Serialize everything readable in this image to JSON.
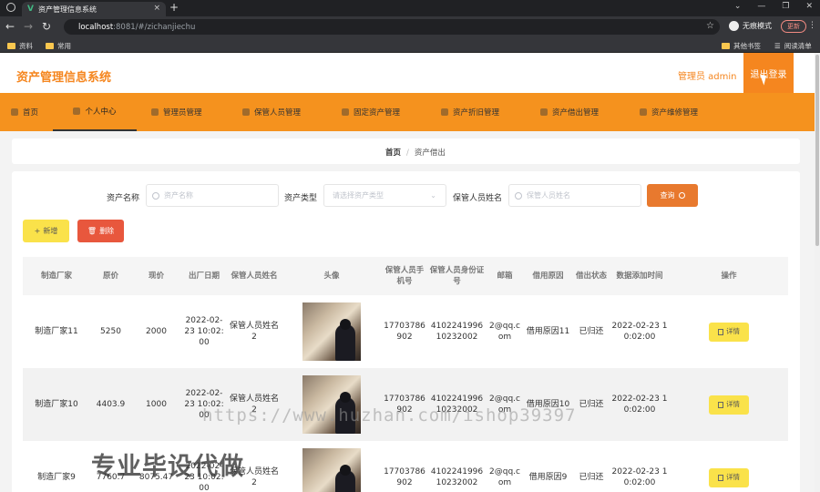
{
  "browser": {
    "tab_title": "资产管理信息系统",
    "tab_close": "×",
    "new_tab": "+",
    "url_host": "localhost",
    "url_rest": ":8081/#/zichanjiechu",
    "incognito": "无痕模式",
    "update": "更新",
    "window_controls": [
      "⌄",
      "—",
      "❐",
      "✕"
    ],
    "bookmarks": [
      "资料",
      "常用"
    ],
    "bookmarks_right": [
      "其他书签",
      "阅读清单"
    ]
  },
  "header": {
    "title": "资产管理信息系统",
    "user": "管理员 admin",
    "logout": "退出登录"
  },
  "nav": {
    "items": [
      {
        "label": "首页",
        "active": false
      },
      {
        "label": "个人中心",
        "active": true
      },
      {
        "label": "管理员管理",
        "active": false
      },
      {
        "label": "保管人员管理",
        "active": false
      },
      {
        "label": "固定资产管理",
        "active": false
      },
      {
        "label": "资产折旧管理",
        "active": false
      },
      {
        "label": "资产借出管理",
        "active": false
      },
      {
        "label": "资产维修管理",
        "active": false
      }
    ]
  },
  "breadcrumb": {
    "home": "首页",
    "separator": "/",
    "current": "资产借出"
  },
  "search": {
    "asset_name_label": "资产名称",
    "asset_name_placeholder": "资产名称",
    "asset_type_label": "资产类型",
    "asset_type_placeholder": "请选择资产类型",
    "keeper_label": "保管人员姓名",
    "keeper_placeholder": "保管人员姓名",
    "search_button": "查询"
  },
  "actions": {
    "add": "新增",
    "delete": "删除"
  },
  "table": {
    "headers": [
      "制造厂家",
      "原价",
      "现价",
      "出厂日期",
      "保管人员姓名",
      "头像",
      "保管人员手机号",
      "保管人员身份证号",
      "邮箱",
      "借用原因",
      "借出状态",
      "数据添加时间",
      "操作"
    ],
    "detail_label": "详情",
    "rows": [
      {
        "maker": "制造厂家11",
        "orig": "5250",
        "cur": "2000",
        "date": "2022-02-23 10:02:00",
        "keeper": "保管人员姓名2",
        "phone": "17703786902",
        "idno": "410224199610232002",
        "email": "2@qq.com",
        "reason": "借用原因11",
        "status": "已归还",
        "added": "2022-02-23 10:02:00"
      },
      {
        "maker": "制造厂家10",
        "orig": "4403.9",
        "cur": "1000",
        "date": "2022-02-23 10:02:00",
        "keeper": "保管人员姓名2",
        "phone": "17703786902",
        "idno": "410224199610232002",
        "email": "2@qq.com",
        "reason": "借用原因10",
        "status": "已归还",
        "added": "2022-02-23 10:02:00"
      },
      {
        "maker": "制造厂家9",
        "orig": "7760.7",
        "cur": "8075.47",
        "date": "2022-02-23 10:02:00",
        "keeper": "保管人员姓名2",
        "phone": "17703786902",
        "idno": "410224199610232002",
        "email": "2@qq.com",
        "reason": "借用原因9",
        "status": "已归还",
        "added": "2022-02-23 10:02:00"
      }
    ]
  },
  "watermark": {
    "url": "https://www.huzhan.com/ishop39397",
    "text": "专业毕设代做"
  }
}
